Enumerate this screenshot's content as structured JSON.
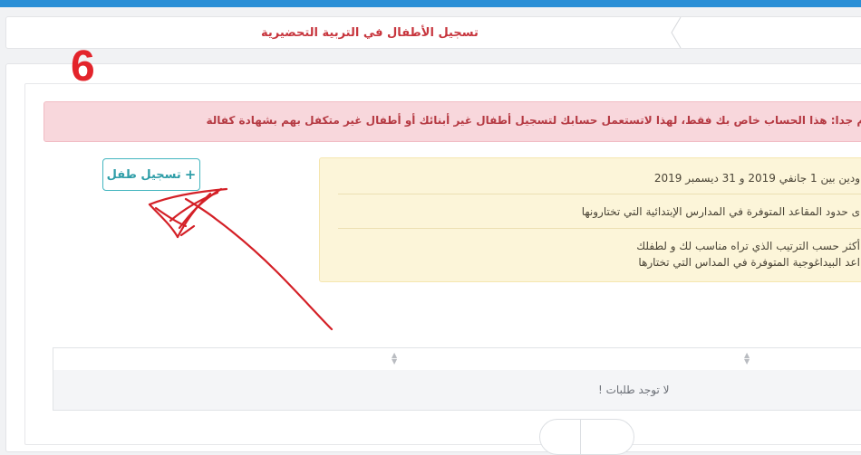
{
  "header": {
    "page_title": "تسجيل الأطفال في التربية التحضيرية"
  },
  "annotation": {
    "step_number": "6",
    "color": "#e3242b"
  },
  "alerts": {
    "danger_text": "هام جدا: هذا الحساب خاص بك فقط، لهذا لاتستعمل حسابك لتسجيل أطفال غير أبنائك أو أطفال غير متكفل بهم بشهادة كفالة",
    "notes": [
      "ودين بين 1 جانفي 2019 و 31 ديسمبر 2019",
      "ى حدود المقاعد المتوفرة في المدارس الإبتدائية التي تختارونها",
      "أكثر حسب الترتيب الذي تراه مناسب لك و لطفلك",
      "اعد البيداغوجية المتوفرة في المداس التي تختارها"
    ]
  },
  "actions": {
    "register_child_label": "تسجيل طفل",
    "plus_icon": "+"
  },
  "table": {
    "empty_message": "لا توجد طلبات !"
  },
  "colors": {
    "topbar": "#2a8fd6",
    "title_red": "#c7353d",
    "button_teal": "#2f9ea8",
    "danger_bg": "#f8d7dc",
    "warning_bg": "#fcf5d9"
  }
}
